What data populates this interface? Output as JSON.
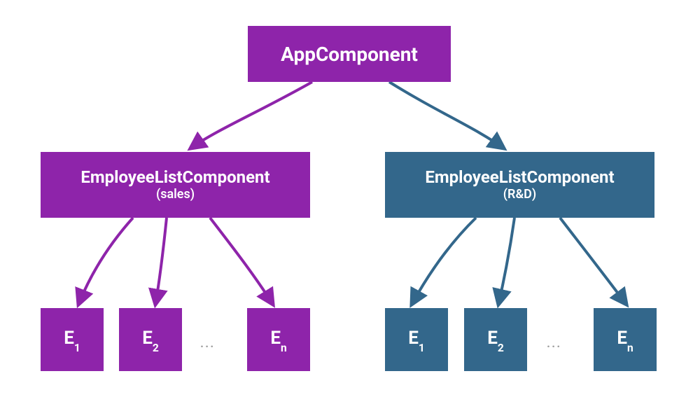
{
  "colors": {
    "purple": "#8e24aa",
    "blue": "#33678b"
  },
  "root": {
    "label": "AppComponent"
  },
  "left": {
    "title": "EmployeeListComponent",
    "subtitle": "(sales)",
    "leaves": {
      "e1_prefix": "E",
      "e1_sub": "1",
      "e2_prefix": "E",
      "e2_sub": "2",
      "en_prefix": "E",
      "en_sub": "n"
    },
    "ellipsis": "..."
  },
  "right": {
    "title": "EmployeeListComponent",
    "subtitle": "(R&D)",
    "leaves": {
      "e1_prefix": "E",
      "e1_sub": "1",
      "e2_prefix": "E",
      "e2_sub": "2",
      "en_prefix": "E",
      "en_sub": "n"
    },
    "ellipsis": "..."
  }
}
